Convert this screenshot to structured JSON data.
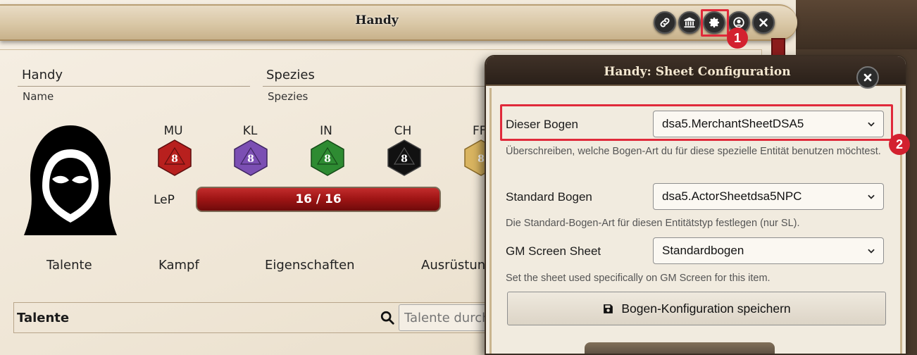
{
  "sheet": {
    "title": "Handy",
    "name_value": "Handy",
    "name_caption": "Name",
    "species_value": "Spezies",
    "species_caption": "Spezies",
    "attributes": [
      {
        "label": "MU",
        "die": "8",
        "color": "#b8201e"
      },
      {
        "label": "KL",
        "die": "8",
        "color": "#7b4fb3"
      },
      {
        "label": "IN",
        "die": "8",
        "color": "#2e8b32"
      },
      {
        "label": "CH",
        "die": "8",
        "color": "#111111"
      },
      {
        "label": "FF",
        "die": "8",
        "color": "#d9b460"
      }
    ],
    "lep_label": "LeP",
    "lep_value": "16 / 16",
    "tabs": [
      "Talente",
      "Kampf",
      "Eigenschaften",
      "Ausrüstun"
    ],
    "talent_section_title": "Talente",
    "talent_search_placeholder": "Talente durch"
  },
  "header_buttons": [
    {
      "name": "link-icon"
    },
    {
      "name": "bank-icon"
    },
    {
      "name": "gear-icon"
    },
    {
      "name": "user-icon"
    },
    {
      "name": "close-icon"
    }
  ],
  "annotations": [
    "1",
    "2"
  ],
  "dialog": {
    "title": "Handy: Sheet Configuration",
    "this_sheet_label": "Dieser Bogen",
    "this_sheet_value": "dsa5.MerchantSheetDSA5",
    "this_sheet_hint": "Überschreiben, welche Bogen-Art du für diese spezielle Entität benutzen möchtest.",
    "default_sheet_label": "Standard Bogen",
    "default_sheet_value": "dsa5.ActorSheetdsa5NPC",
    "default_sheet_hint": "Die Standard-Bogen-Art für diesen Entitätstyp festlegen (nur SL).",
    "gm_screen_label": "GM Screen Sheet",
    "gm_screen_value": "Standardbogen",
    "gm_screen_hint": "Set the sheet used specifically on GM Screen for this item.",
    "save_label": "Bogen-Konfiguration speichern"
  },
  "colors": {
    "highlight": "#e0293a",
    "lep_bar": "#9d1414"
  }
}
